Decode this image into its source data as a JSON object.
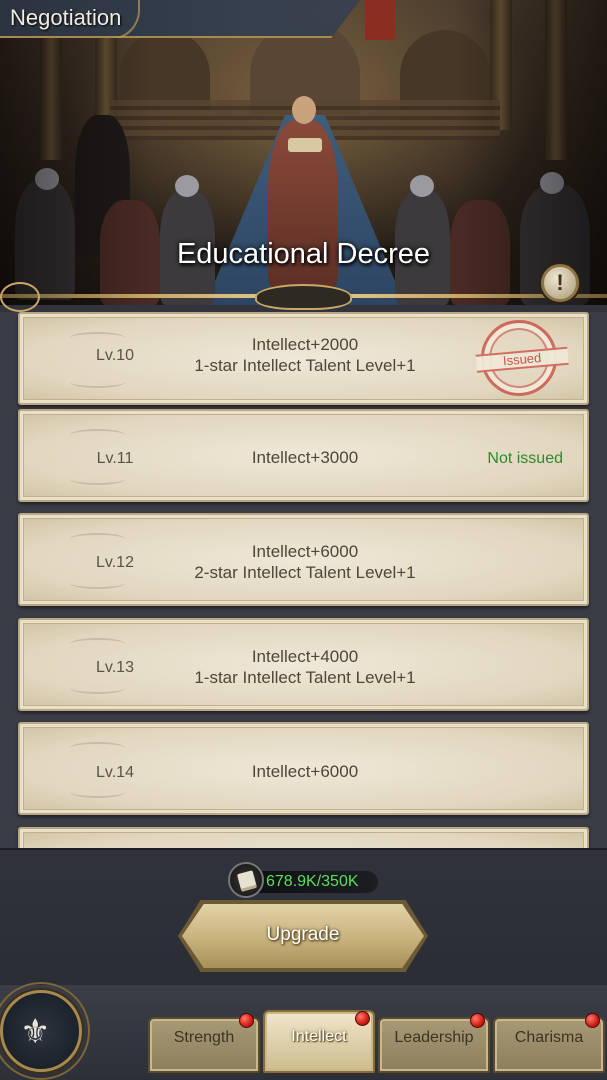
{
  "header": {
    "title": "Negotiation"
  },
  "hero": {
    "title": "Educational Decree"
  },
  "info_button": {
    "icon": "exclamation-icon",
    "glyph": "!"
  },
  "decrees": [
    {
      "level": "Lv.10",
      "reward_1": "Intellect+2000",
      "reward_2": "1-star Intellect Talent Level+1",
      "status": "Issued",
      "status_style": "stamp"
    },
    {
      "level": "Lv.11",
      "reward_1": "Intellect+3000",
      "reward_2": "",
      "status": "Not issued",
      "status_style": "text"
    },
    {
      "level": "Lv.12",
      "reward_1": "Intellect+6000",
      "reward_2": "2-star Intellect Talent Level+1",
      "status": "",
      "status_style": "none"
    },
    {
      "level": "Lv.13",
      "reward_1": "Intellect+4000",
      "reward_2": "1-star Intellect Talent Level+1",
      "status": "",
      "status_style": "none"
    },
    {
      "level": "Lv.14",
      "reward_1": "Intellect+6000",
      "reward_2": "",
      "status": "",
      "status_style": "none"
    }
  ],
  "resource": {
    "icon": "scroll-icon",
    "amount": "678.9K/350K"
  },
  "upgrade": {
    "label": "Upgrade"
  },
  "emblem": {
    "icon": "fleur-de-lis-icon",
    "glyph": "⚜"
  },
  "tabs": [
    {
      "label": "Strength",
      "active": false,
      "badge": true
    },
    {
      "label": "Intellect",
      "active": true,
      "badge": true
    },
    {
      "label": "Leadership",
      "active": false,
      "badge": true
    },
    {
      "label": "Charisma",
      "active": false,
      "badge": true
    }
  ],
  "colors": {
    "not_issued": "#2e8a2e",
    "stamp": "#c4554a",
    "resource_amount": "#57e05a",
    "gold_trim": "#c9a866"
  }
}
